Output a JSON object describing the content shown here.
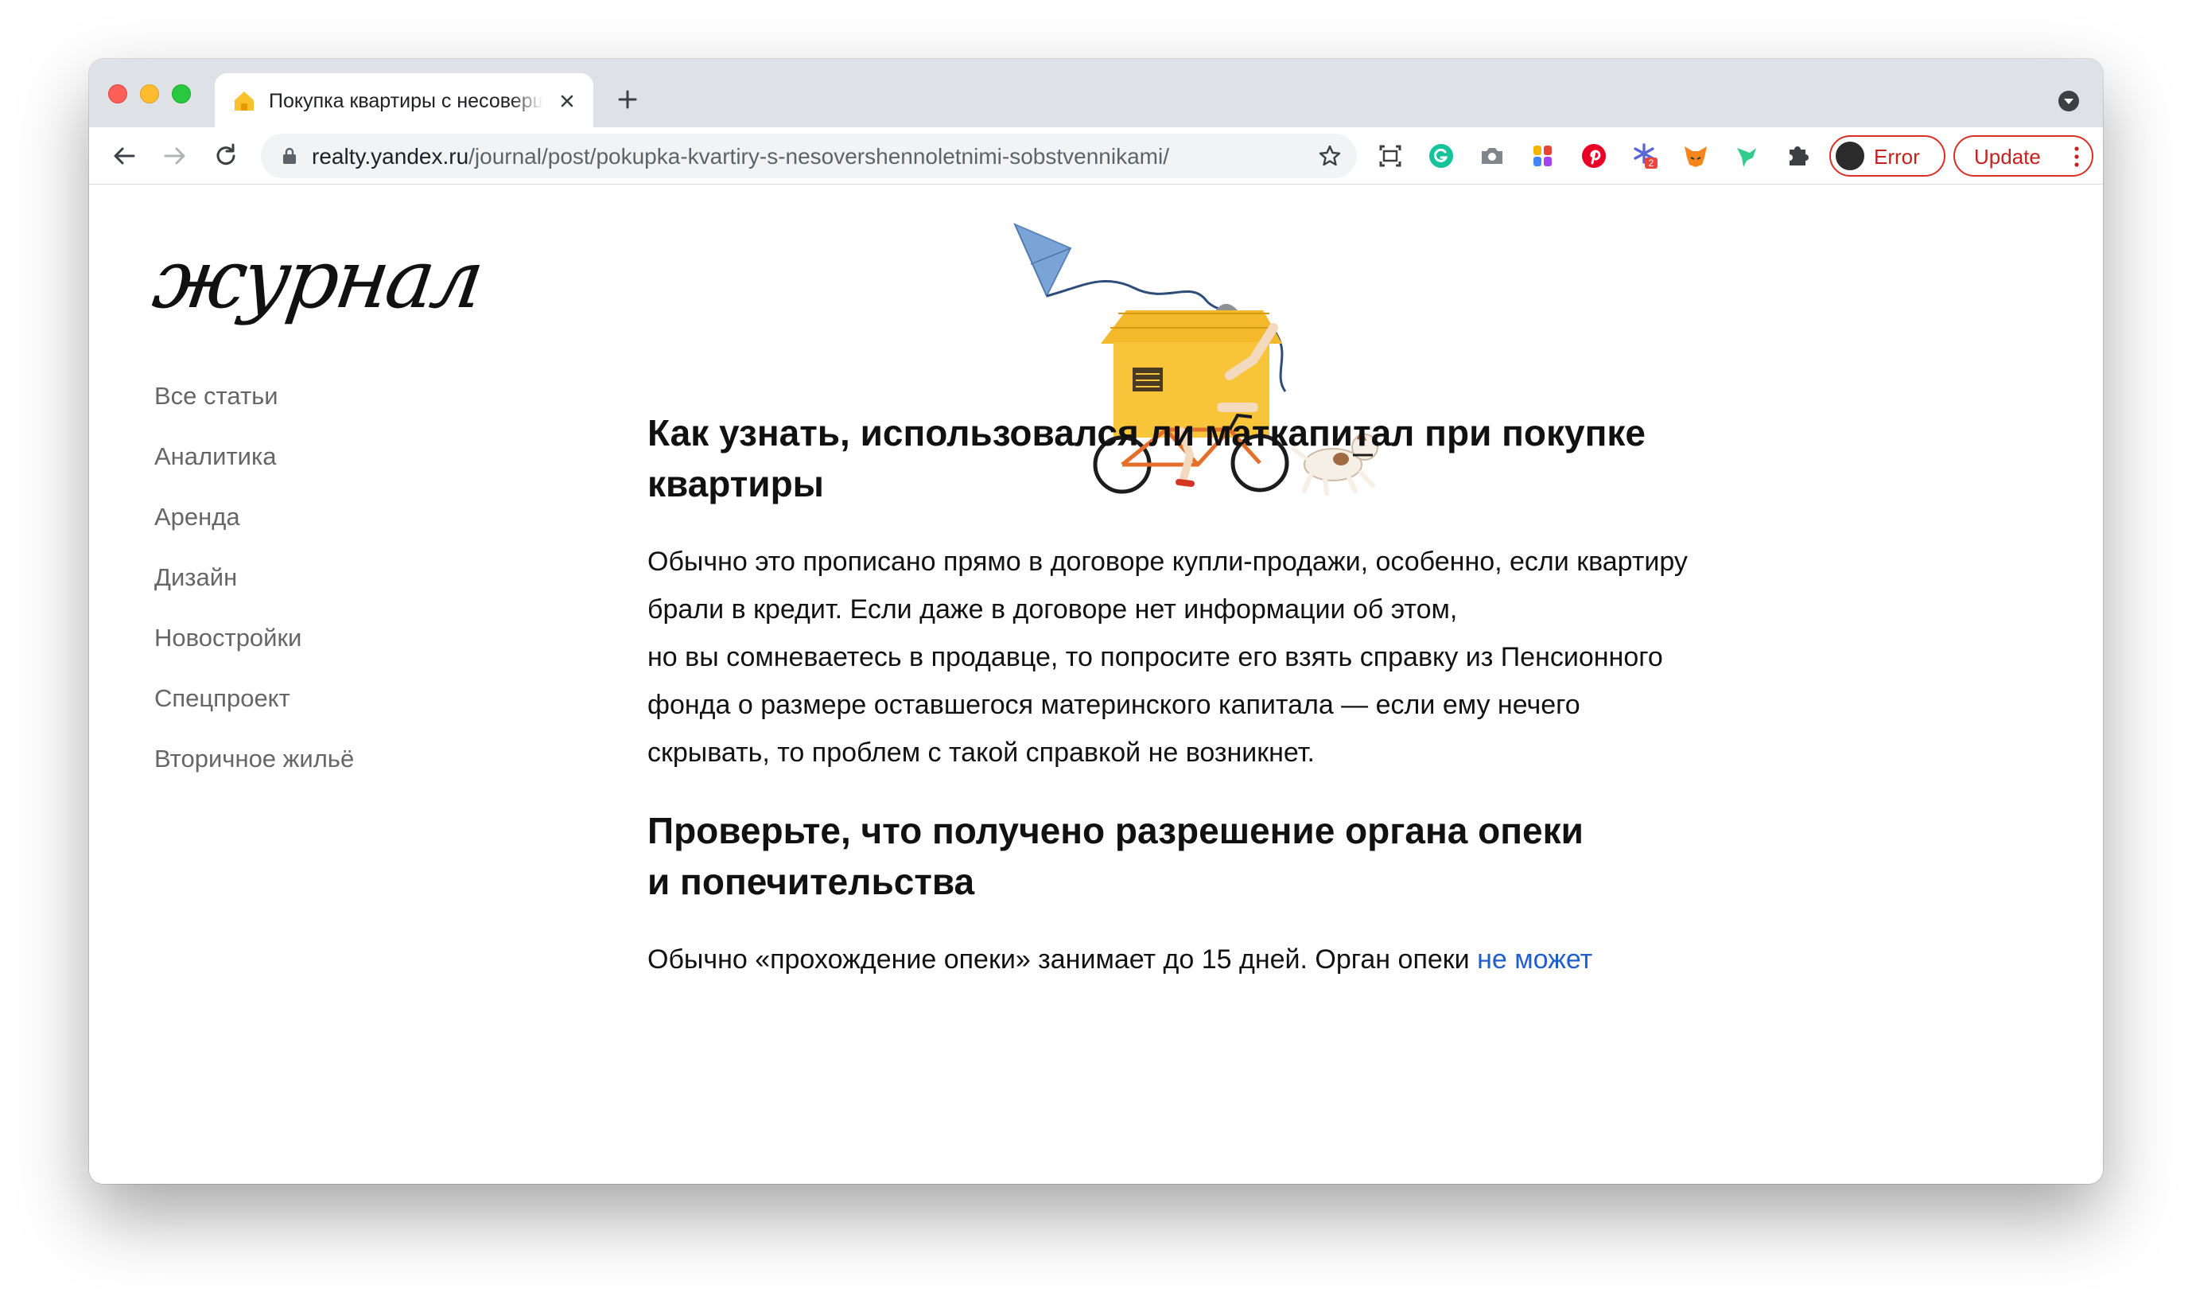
{
  "browser": {
    "tab_title": "Покупка квартиры с несовершеннолетними собственниками",
    "url_host": "realty.yandex.ru",
    "url_path": "/journal/post/pokupka-kvartiry-s-nesovershennoletnimi-sobstvennikami/",
    "error_label": "Error",
    "update_label": "Update",
    "extension_badge": "2",
    "accent_color": "#d93025"
  },
  "site": {
    "logo": "журнал",
    "nav": [
      {
        "label": "Все статьи"
      },
      {
        "label": "Аналитика"
      },
      {
        "label": "Аренда"
      },
      {
        "label": "Дизайн"
      },
      {
        "label": "Новостройки"
      },
      {
        "label": "Спецпроект"
      },
      {
        "label": "Вторичное жильё"
      }
    ]
  },
  "article": {
    "heading1_line1": "Как узнать, использовался ли маткапитал при покупке",
    "heading1_line2": "квартиры",
    "para1": [
      "Обычно это прописано прямо в договоре купли-продажи, особенно, если квартиру",
      "брали в кредит. Если даже в договоре нет информации об этом,",
      "но вы сомневаетесь в продавце, то попросите его взять справку из Пенсионного",
      "фонда о размере оставшегося материнского капитала — если ему нечего",
      "скрывать, то проблем с такой справкой не возникнет."
    ],
    "heading2_line1": "Проверьте, что получено разрешение органа опеки",
    "heading2_line2": "и попечительства",
    "para2_text": "Обычно «прохождение опеки» занимает до 15 дней. Орган опеки ",
    "para2_link": "не может"
  }
}
